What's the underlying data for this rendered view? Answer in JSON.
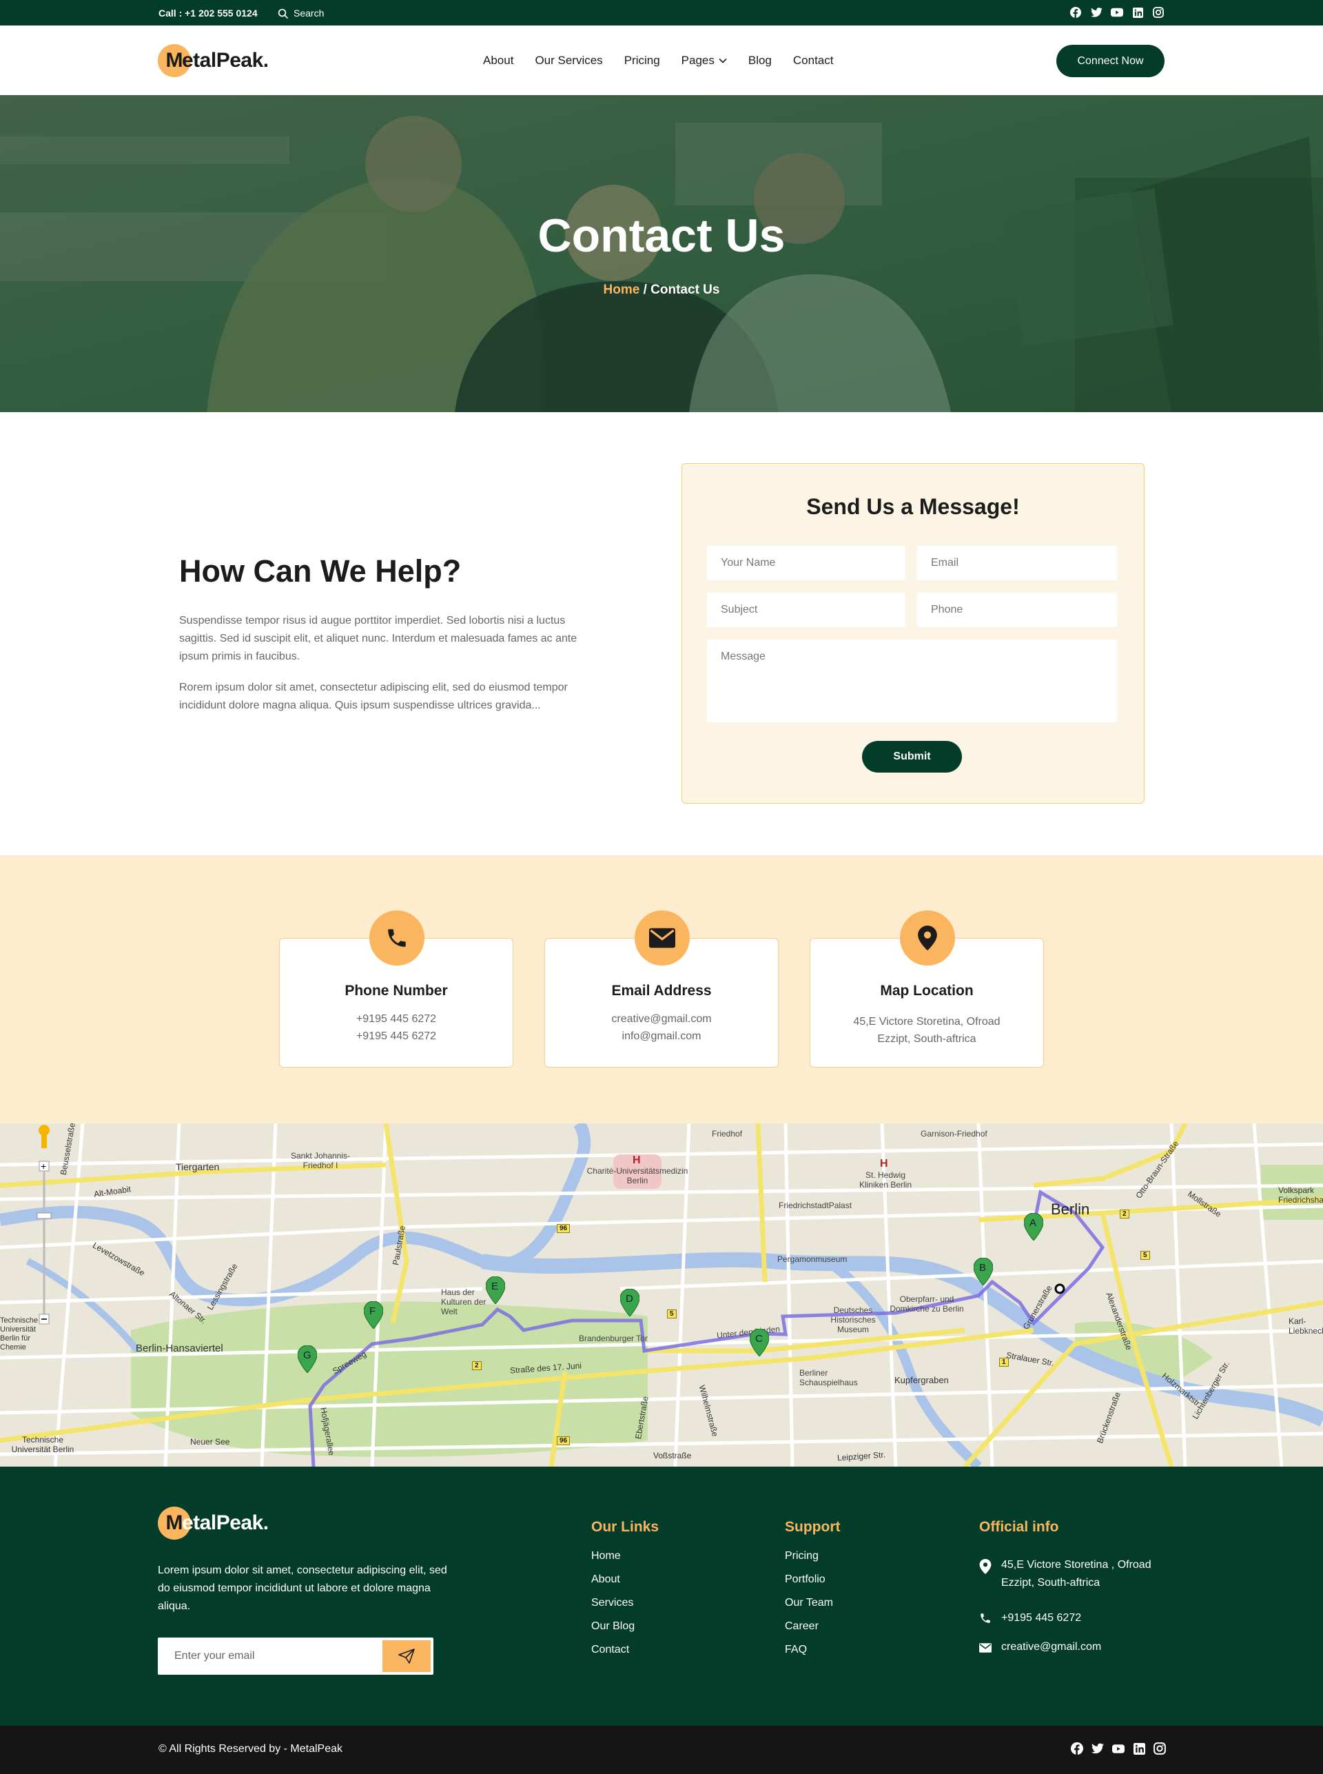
{
  "topbar": {
    "call": "Call : +1 202 555 0124",
    "search": "Search",
    "socials": [
      "facebook-icon",
      "twitter-icon",
      "youtube-icon",
      "linkedin-icon",
      "instagram-icon"
    ]
  },
  "brand": {
    "initial": "M",
    "rest": "etalPeak."
  },
  "nav": {
    "items": [
      "About",
      "Our Services",
      "Pricing",
      "Pages",
      "Blog",
      "Contact"
    ],
    "cta": "Connect Now"
  },
  "hero": {
    "title": "Contact Us",
    "crumb_home": "Home",
    "crumb_sep": " / ",
    "crumb_current": "Contact Us"
  },
  "help": {
    "title": "How Can We Help?",
    "p1": "Suspendisse tempor risus id augue porttitor imperdiet. Sed lobortis nisi a luctus sagittis. Sed id suscipit elit, et aliquet nunc. Interdum et malesuada fames ac ante ipsum primis in faucibus.",
    "p2": "Rorem ipsum dolor sit amet, consectetur adipiscing elit, sed do eiusmod tempor incididunt dolore magna aliqua. Quis ipsum suspendisse ultrices gravida..."
  },
  "form": {
    "title": "Send Us a Message!",
    "name_ph": "Your Name",
    "email_ph": "Email",
    "subject_ph": "Subject",
    "phone_ph": "Phone",
    "message_ph": "Message",
    "submit": "Submit"
  },
  "info": {
    "phone": {
      "title": "Phone Number",
      "l1": "+9195 445 6272",
      "l2": "+9195 445 6272"
    },
    "email": {
      "title": "Email Address",
      "l1": "creative@gmail.com",
      "l2": "info@gmail.com"
    },
    "map": {
      "title": "Map Location",
      "l1": "45,E Victore Storetina, Ofroad",
      "l2": "Ezzipt, South-aftrica"
    }
  },
  "map": {
    "labels": [
      "Tiergarten",
      "Alt-Moabit",
      "Sankt Johannis-Friedhof I",
      "Charité-Universitätsmedizin Berlin",
      "Friedhof",
      "Garnison-Friedhof",
      "St. Hedwig Kliniken Berlin",
      "Berlin",
      "FriedrichstadtPalast",
      "Pergamonmuseum",
      "Haus der Kulturen der Welt",
      "Brandenburger Tor",
      "Unter den Linden",
      "Deutsches Historisches Museum",
      "Oberpfarr- und Domkirche zu Berlin",
      "Berliner Schauspielhaus",
      "Kupfergraben",
      "Stralauer Str.",
      "Berlin-Hansaviertel",
      "Straße des 17. Juni",
      "Neuer See",
      "Technische Universität Berlin",
      "Leipziger Str.",
      "Voßstraße",
      "Ebertstraße",
      "Wilhelmstraße",
      "Paulstraße",
      "Lessingstraße",
      "Levetzowstraße",
      "Altonaer Str.",
      "Spreeweg",
      "Hofjägerallee",
      "Alexanderstraße",
      "Grunerstraße",
      "Brückenstraße",
      "Lichtenberger Str.",
      "Holzmarktstr.",
      "Mollstraße",
      "Otto-Braun-Straße",
      "Karl-Liebknecht",
      "Volkspark Friedrichshain",
      "Technische Universität Berlin für Chemie",
      "Beusselstraße"
    ],
    "markers": [
      "A",
      "B",
      "C",
      "D",
      "E",
      "F",
      "G"
    ],
    "roads": [
      "96",
      "5",
      "2",
      "1",
      "5",
      "2",
      "96"
    ]
  },
  "footer": {
    "desc": "Lorem ipsum dolor sit amet, consectetur adipiscing elit, sed do eiusmod tempor incididunt ut labore et dolore magna aliqua.",
    "email_ph": "Enter your email",
    "links_title": "Our Links",
    "links": [
      "Home",
      "About",
      "Services",
      "Our Blog",
      "Contact"
    ],
    "support_title": "Support",
    "support": [
      "Pricing",
      "Portfolio",
      "Our Team",
      "Career",
      "FAQ"
    ],
    "official_title": "Official info",
    "address": "45,E Victore Storetina , Ofroad Ezzipt, South-aftrica",
    "phone": "+9195 445 6272",
    "email": "creative@gmail.com"
  },
  "bottom": {
    "copyright": "© All Rights Reserved by - MetalPeak"
  },
  "colors": {
    "primary": "#043c2a",
    "accent": "#fbb55f",
    "cream": "#fdeccd",
    "form_bg": "#fcf5e5"
  }
}
